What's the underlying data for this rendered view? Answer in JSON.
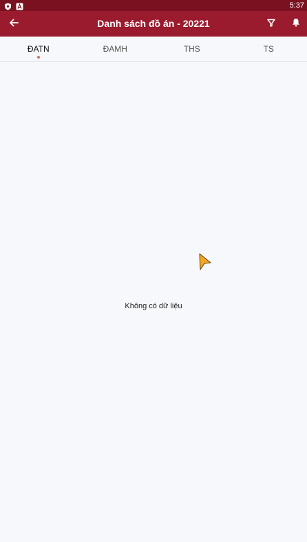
{
  "status_bar": {
    "time": "5:37",
    "icons": [
      "shield-icon",
      "a-icon"
    ]
  },
  "app_bar": {
    "title": "Danh sách đồ án - 20221",
    "icons": [
      "back-arrow-icon",
      "filter-icon",
      "bell-icon"
    ]
  },
  "tabs": [
    {
      "label": "ĐATN",
      "active": true
    },
    {
      "label": "ĐAMH",
      "active": false
    },
    {
      "label": "THS",
      "active": false
    },
    {
      "label": "TS",
      "active": false
    }
  ],
  "content": {
    "empty_message": "Không có dữ liệu"
  },
  "colors": {
    "status_bar": "#7a1120",
    "app_bar": "#9b1b2e",
    "background": "#f7f8fc",
    "active_indicator": "#e06a6a",
    "cursor": "#f5a623"
  }
}
